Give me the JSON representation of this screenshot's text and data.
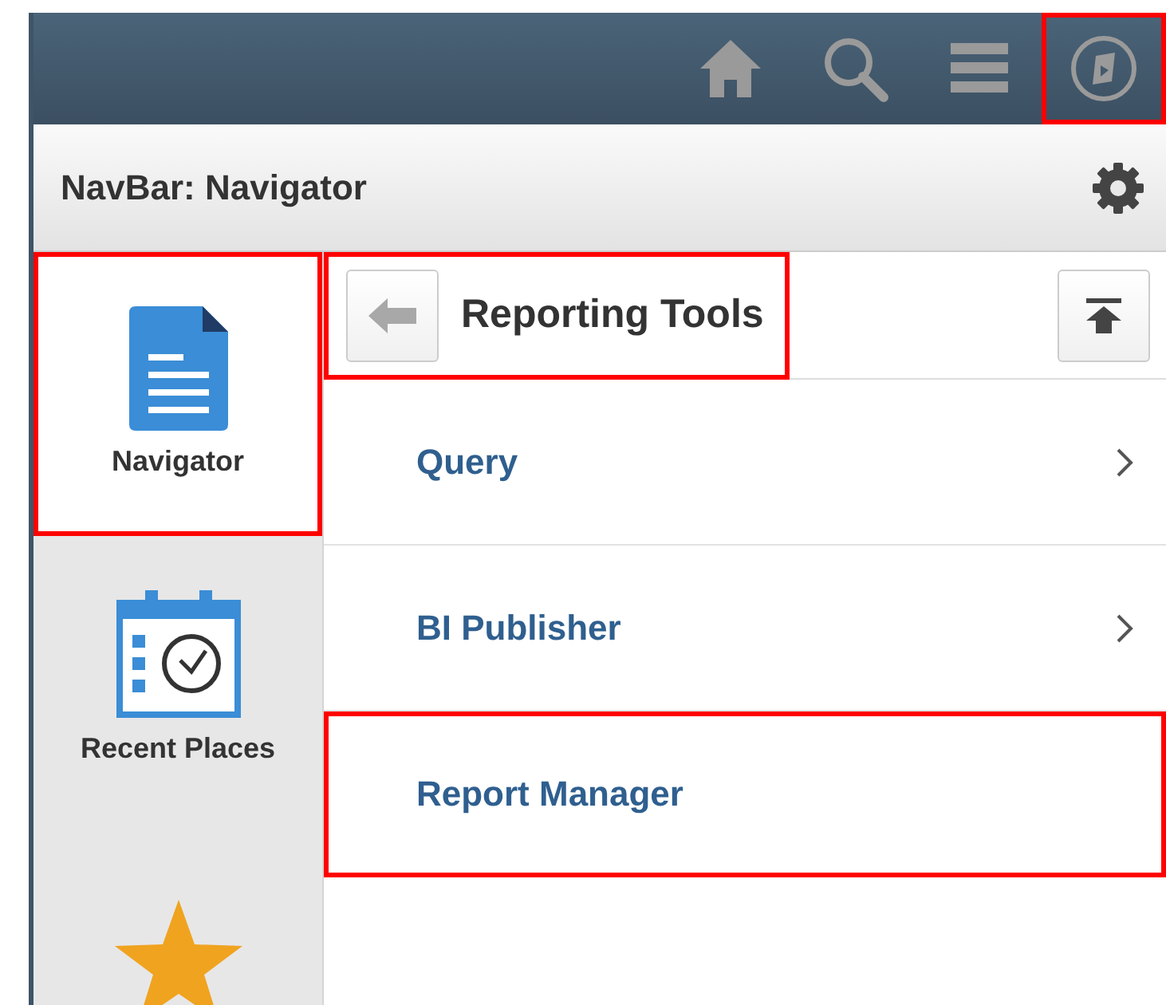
{
  "header_icons": [
    {
      "kind": "home",
      "highlighted": false
    },
    {
      "kind": "search",
      "highlighted": false
    },
    {
      "kind": "menu",
      "highlighted": false
    },
    {
      "kind": "navigator",
      "highlighted": true
    }
  ],
  "panel": {
    "title": "NavBar: Navigator"
  },
  "sidebar": {
    "items": [
      {
        "kind": "document",
        "label": "Navigator",
        "selected": true,
        "highlighted": true
      },
      {
        "kind": "calendar",
        "label": "Recent Places",
        "selected": false,
        "highlighted": false
      },
      {
        "kind": "star",
        "selected": false,
        "highlighted": false
      }
    ]
  },
  "folder": {
    "title": "Reporting Tools",
    "highlighted": true
  },
  "menu_items": [
    {
      "label": "Query",
      "has_children": true,
      "highlighted": false
    },
    {
      "label": "BI Publisher",
      "has_children": true,
      "highlighted": false
    },
    {
      "label": "Report Manager",
      "has_children": false,
      "highlighted": true
    }
  ]
}
